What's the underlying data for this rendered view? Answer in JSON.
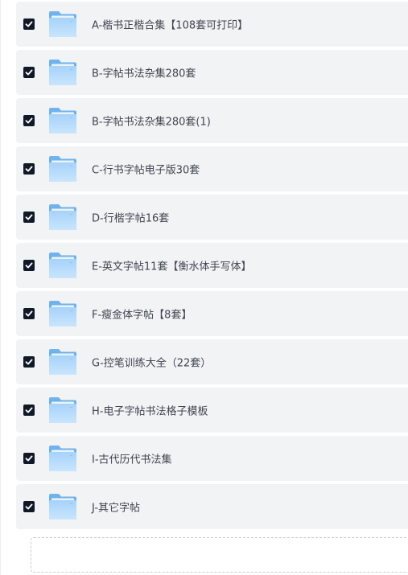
{
  "files": [
    {
      "name": "A-楷书正楷合集【108套可打印】",
      "checked": true,
      "icon": "folder-icon"
    },
    {
      "name": "B-字帖书法杂集280套",
      "checked": true,
      "icon": "folder-icon"
    },
    {
      "name": "B-字帖书法杂集280套(1)",
      "checked": true,
      "icon": "folder-icon"
    },
    {
      "name": "C-行书字帖电子版30套",
      "checked": true,
      "icon": "folder-icon"
    },
    {
      "name": "D-行楷字帖16套",
      "checked": true,
      "icon": "folder-icon"
    },
    {
      "name": "E-英文字帖11套【衡水体手写体】",
      "checked": true,
      "icon": "folder-icon"
    },
    {
      "name": "F-瘦金体字帖【8套】",
      "checked": true,
      "icon": "folder-icon"
    },
    {
      "name": "G-控笔训练大全（22套）",
      "checked": true,
      "icon": "folder-icon"
    },
    {
      "name": "H-电子字帖书法格子模板",
      "checked": true,
      "icon": "folder-icon"
    },
    {
      "name": "I-古代历代书法集",
      "checked": true,
      "icon": "folder-icon"
    },
    {
      "name": "J-其它字帖",
      "checked": true,
      "icon": "folder-icon"
    }
  ],
  "colors": {
    "row_bg": "#f2f3f5",
    "checkbox": "#111827",
    "folder_light": "#b9dcfb",
    "folder_dark": "#6aaee9",
    "text": "#3f4450"
  }
}
